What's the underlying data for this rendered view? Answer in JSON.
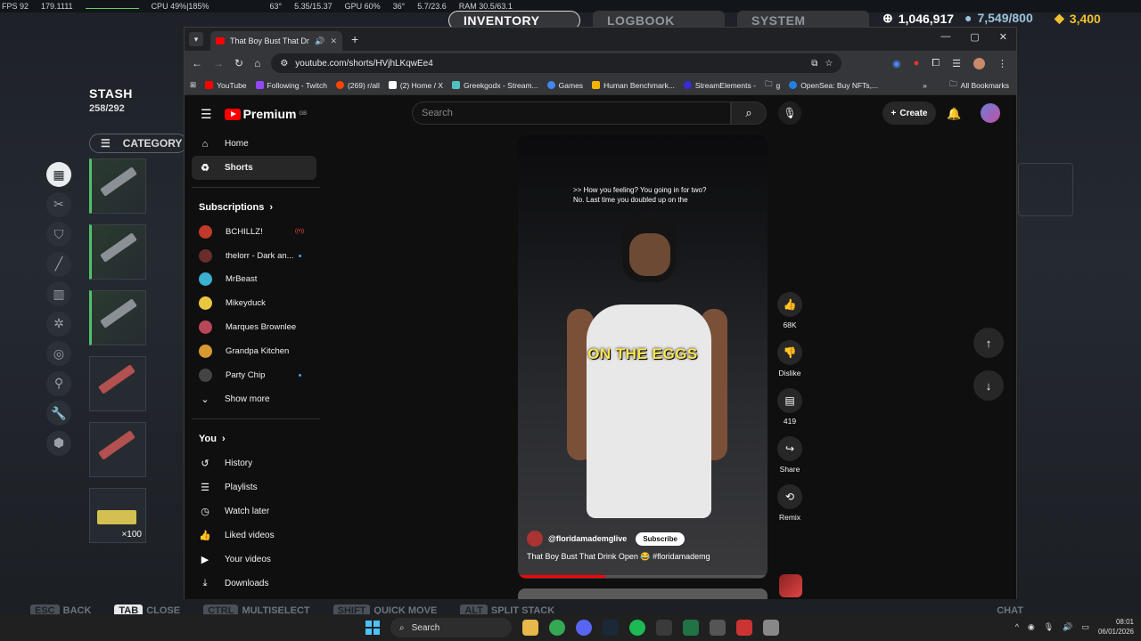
{
  "hud": {
    "fps": "FPS 92",
    "frametime": "179.1111",
    "cpu": "CPU 49%|185%",
    "gpu_temp": "63°",
    "mem1": "5.35/15.37",
    "gpu": "GPU 60%",
    "gpu_temp2": "36°",
    "mem2": "5.7/23.6",
    "ram": "RAM 30.5/63.1"
  },
  "game": {
    "tabs": [
      "INVENTORY",
      "LOGBOOK",
      "SYSTEM"
    ],
    "currency": {
      "coins": "1,046,917",
      "raiders": "7,549/800",
      "premium": "3,400"
    },
    "stash_title": "STASH",
    "stash_count": "258/292",
    "category_label": "CATEGORY",
    "slot_qty": "×100",
    "bottom_hints": [
      {
        "key": "ESC",
        "label": "BACK"
      },
      {
        "key": "TAB",
        "label": "CLOSE"
      },
      {
        "key": "CTRL",
        "label": "MULTISELECT"
      },
      {
        "key": "SHIFT",
        "label": "QUICK MOVE"
      },
      {
        "key": "ALT",
        "label": "SPLIT STACK"
      }
    ],
    "chat": "CHAT"
  },
  "browser": {
    "tab_title": "That Boy Bust That Drink O",
    "url": "youtube.com/shorts/HVjhLKqwEe4",
    "bookmarks": [
      {
        "label": "YouTube",
        "color": "#ff0000"
      },
      {
        "label": "Following - Twitch",
        "color": "#9146ff"
      },
      {
        "label": "(269) r/all",
        "color": "#ff4500"
      },
      {
        "label": "(2) Home / X",
        "color": "#ffffff"
      },
      {
        "label": "Greekgodx - Stream...",
        "color": "#53c0c0"
      },
      {
        "label": "Games",
        "color": "#4285f4"
      },
      {
        "label": "Human Benchmark...",
        "color": "#f4b400"
      },
      {
        "label": "StreamElements -",
        "color": "#3a2bd8"
      },
      {
        "label": "g",
        "color": "#888888"
      },
      {
        "label": "OpenSea: Buy NFTs,...",
        "color": "#2081e2"
      }
    ],
    "all_bookmarks": "All Bookmarks"
  },
  "youtube": {
    "logo_text": "Premium",
    "logo_region": "GB",
    "search_placeholder": "Search",
    "create_label": "Create",
    "nav": [
      {
        "label": "Home",
        "icon": "home-icon"
      },
      {
        "label": "Shorts",
        "icon": "shorts-icon"
      }
    ],
    "subscriptions_label": "Subscriptions",
    "subscriptions": [
      {
        "name": "BCHILLZ!",
        "color": "#c0392b",
        "indicator": "live"
      },
      {
        "name": "thelorr - Dark an...",
        "color": "#6a2c2c",
        "indicator": "dot"
      },
      {
        "name": "MrBeast",
        "color": "#3bb0d0",
        "indicator": ""
      },
      {
        "name": "Mikeyduck",
        "color": "#e9c83f",
        "indicator": ""
      },
      {
        "name": "Marques Brownlee",
        "color": "#b8475a",
        "indicator": ""
      },
      {
        "name": "Grandpa Kitchen",
        "color": "#d89a30",
        "indicator": ""
      },
      {
        "name": "Party Chip",
        "color": "#444444",
        "indicator": "dot"
      }
    ],
    "show_more": "Show more",
    "you_label": "You",
    "you_items": [
      {
        "label": "History",
        "icon": "history-icon"
      },
      {
        "label": "Playlists",
        "icon": "playlists-icon"
      },
      {
        "label": "Watch later",
        "icon": "watch-later-icon"
      },
      {
        "label": "Liked videos",
        "icon": "liked-icon"
      },
      {
        "label": "Your videos",
        "icon": "your-videos-icon"
      },
      {
        "label": "Downloads",
        "icon": "downloads-icon"
      }
    ],
    "short": {
      "caption_line1": ">> How you feeling? You going in for two?",
      "caption_line2": "No. Last time you doubled up on the",
      "overlay": "ON THE EGGS",
      "channel": "@floridamademglive",
      "subscribe": "Subscribe",
      "title": "That Boy Bust That Drink Open 😂 #floridamademg",
      "progress": 0.35
    },
    "actions": {
      "likes": "68K",
      "dislike": "Dislike",
      "comments": "419",
      "share": "Share",
      "remix": "Remix"
    }
  },
  "taskbar": {
    "search": "Search",
    "time": "08:01",
    "date": "06/01/2026"
  }
}
